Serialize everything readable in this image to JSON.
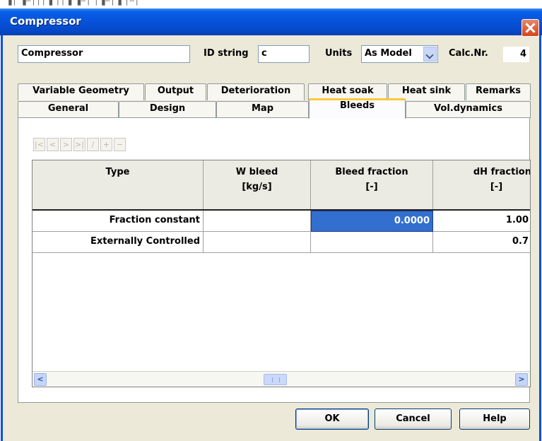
{
  "window": {
    "title": "Compressor"
  },
  "background_text": "▐│ ▐┄│││▐ ││▐ ▐┄│ │▐┄│▐ │┄│",
  "header": {
    "name_value": "Compressor",
    "id_string_label": "ID string",
    "id_string_value": "c",
    "units_label": "Units",
    "units_value": "As Model",
    "calc_nr_label": "Calc.Nr.",
    "calc_nr_value": "4"
  },
  "tabs_row1": [
    "Variable Geometry",
    "Output",
    "Deterioration",
    "Heat soak",
    "Heat sink",
    "Remarks"
  ],
  "tabs_row2": [
    "General",
    "Design",
    "Map",
    "Bleeds",
    "Vol.dynamics"
  ],
  "active_tab": "Bleeds",
  "toolbar_icons": [
    "first-row-icon",
    "prev-row-icon",
    "next-row-icon",
    "last-row-icon",
    "insert-row-icon",
    "append-row-icon",
    "delete-row-icon"
  ],
  "grid": {
    "columns": [
      {
        "title": "Type",
        "unit": ""
      },
      {
        "title": "W bleed",
        "unit": "[kg/s]"
      },
      {
        "title": "Bleed fraction",
        "unit": "[-]"
      },
      {
        "title": "dH fraction",
        "unit": "[-]"
      }
    ],
    "rows": [
      {
        "type": "Fraction constant",
        "w_bleed": "",
        "bleed_fraction": "0.0000",
        "dh_fraction": "1.00"
      },
      {
        "type": "Externally Controlled",
        "w_bleed": "",
        "bleed_fraction": "",
        "dh_fraction": "0.7"
      }
    ]
  },
  "buttons": {
    "ok": "OK",
    "cancel": "Cancel",
    "help": "Help"
  }
}
